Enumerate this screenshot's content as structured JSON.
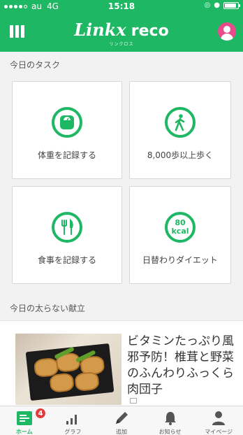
{
  "status_bar": {
    "carrier": "au",
    "network": "4G",
    "time": "15:18"
  },
  "header": {
    "logo": "Linkx",
    "name": "reco",
    "logo_sub": "リンクロス",
    "brand_color": "#1eb763"
  },
  "tasks": {
    "title": "今日のタスク",
    "items": [
      {
        "label": "体重を記録する",
        "icon": "scale-icon"
      },
      {
        "label": "8,000歩以上歩く",
        "icon": "walking-icon"
      },
      {
        "label": "食事を記録する",
        "icon": "fork-knife-icon"
      },
      {
        "label": "日替わりダイエット",
        "icon": "kcal-icon",
        "icon_top": "80",
        "icon_bottom": "kcal"
      }
    ]
  },
  "menu": {
    "title": "今日の太らない献立",
    "recipe": {
      "title": "ビタミンたっぷり風邪予防！椎茸と野菜のふんわりふっくら肉団子"
    }
  },
  "tabbar": {
    "tabs": [
      {
        "label": "ホーム",
        "icon": "home-icon",
        "badge": "4",
        "active": true
      },
      {
        "label": "グラフ",
        "icon": "graph-icon"
      },
      {
        "label": "追加",
        "icon": "pencil-icon"
      },
      {
        "label": "お知らせ",
        "icon": "bell-icon"
      },
      {
        "label": "マイページ",
        "icon": "person-icon"
      }
    ]
  }
}
